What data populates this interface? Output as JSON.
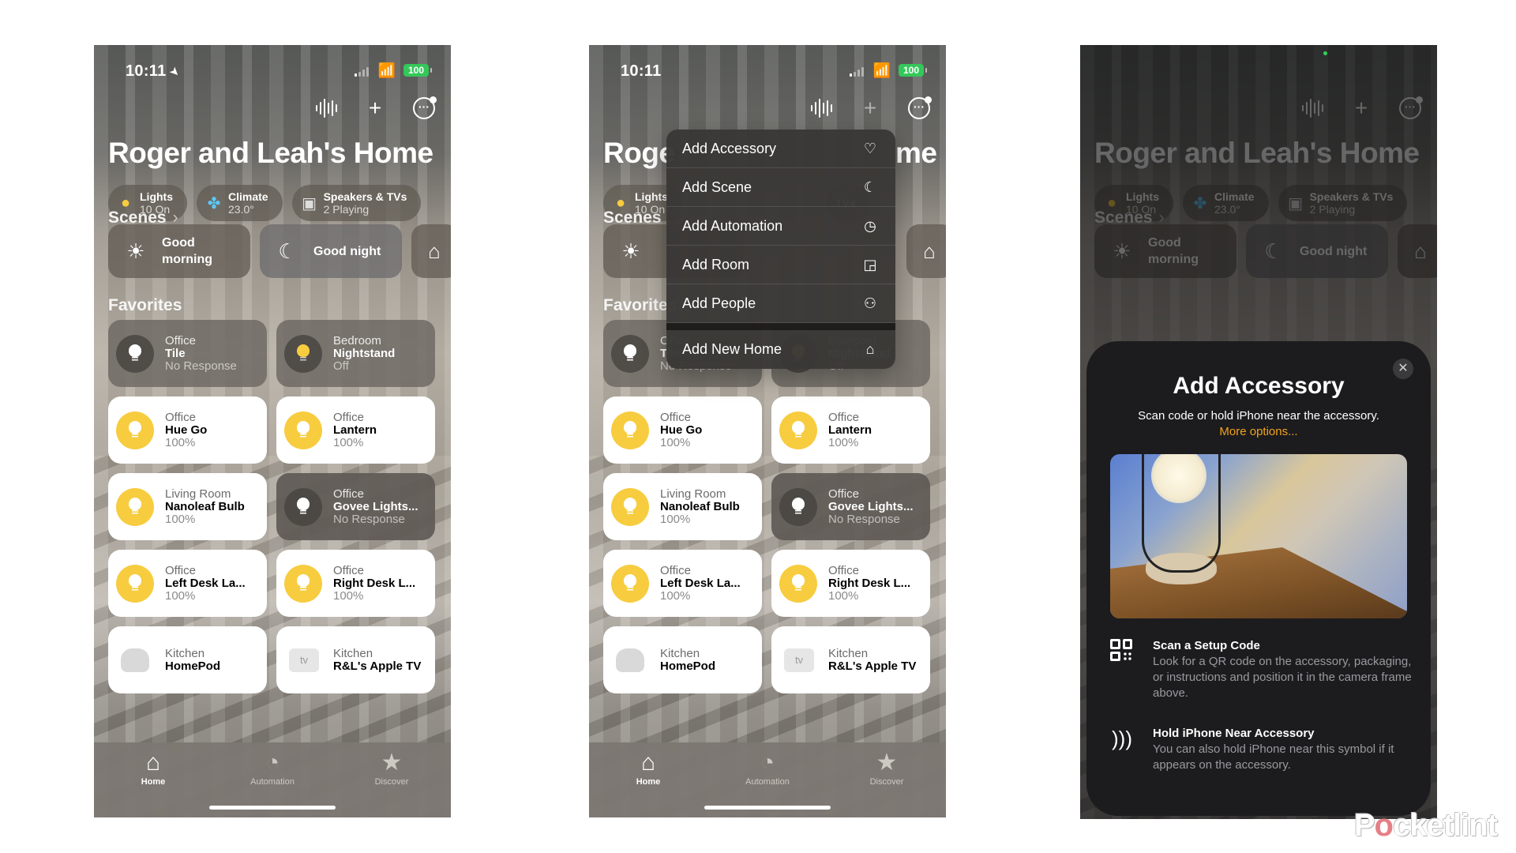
{
  "watermark": {
    "prefix": "P",
    "o": "o",
    "suffix": "cketlint"
  },
  "status": {
    "time": "10:11",
    "battery": "100"
  },
  "home": {
    "title": "Roger and Leah's Home",
    "title_short_left": "Roge",
    "title_short_right": "me",
    "chips": [
      {
        "title": "Lights",
        "subtitle": "10 On",
        "icon": "lightbulb-icon"
      },
      {
        "title": "Climate",
        "subtitle": "23.0°",
        "icon": "fan-icon"
      },
      {
        "title": "Speakers & TVs",
        "subtitle": "2 Playing",
        "icon": "speakers-tv-icon"
      }
    ],
    "scenes_title": "Scenes",
    "scenes": [
      {
        "label": "Good\nmorning",
        "line1": "Good",
        "line2": "morning",
        "icon": "sun-icon"
      },
      {
        "label": "Good night",
        "icon": "moon-icon"
      },
      {
        "label": "",
        "icon": "house-icon"
      }
    ],
    "favorites_title": "Favorites",
    "favorites": [
      {
        "room": "Office",
        "name": "Tile",
        "state": "No Response",
        "style": "off"
      },
      {
        "room": "Bedroom",
        "name": "Nightstand",
        "state": "Off",
        "style": "off"
      },
      {
        "room": "Office",
        "name": "Hue Go",
        "state": "100%",
        "style": "on"
      },
      {
        "room": "Office",
        "name": "Lantern",
        "state": "100%",
        "style": "on"
      },
      {
        "room": "Living Room",
        "name": "Nanoleaf Bulb",
        "state": "100%",
        "style": "on"
      },
      {
        "room": "Office",
        "name": "Govee Lights...",
        "state": "No Response",
        "style": "dark"
      },
      {
        "room": "Office",
        "name": "Left Desk La...",
        "state": "100%",
        "style": "on"
      },
      {
        "room": "Office",
        "name": "Right Desk L...",
        "state": "100%",
        "style": "on"
      },
      {
        "room": "Kitchen",
        "name": "HomePod",
        "state": "",
        "style": "homepod"
      },
      {
        "room": "Kitchen",
        "name": "R&L's Apple TV",
        "state": "",
        "style": "appletv"
      }
    ],
    "tabs": [
      {
        "label": "Home",
        "icon": "house-icon",
        "active": true
      },
      {
        "label": "Automation",
        "icon": "clock-check-icon",
        "active": false
      },
      {
        "label": "Discover",
        "icon": "star-icon",
        "active": false
      }
    ]
  },
  "add_menu": {
    "items": [
      {
        "label": "Add Accessory",
        "icon": "lightbulb-icon",
        "glyph": "💡"
      },
      {
        "label": "Add Scene",
        "icon": "moon-sparkle-icon",
        "glyph": "☾"
      },
      {
        "label": "Add Automation",
        "icon": "alarm-clock-icon",
        "glyph": "⏰"
      },
      {
        "label": "Add Room",
        "icon": "room-icon",
        "glyph": "◲"
      },
      {
        "label": "Add People",
        "icon": "people-icon",
        "glyph": "👥"
      }
    ],
    "footer_item": {
      "label": "Add New Home",
      "icon": "house-icon",
      "glyph": "⌂"
    }
  },
  "add_accessory_sheet": {
    "title": "Add Accessory",
    "subtitle": "Scan code or hold iPhone near the accessory.",
    "more_options": "More options...",
    "more_options_color": "#f0a21c",
    "options": [
      {
        "heading": "Scan a Setup Code",
        "body": "Look for a QR code on the accessory, packaging, or instructions and position it in the camera frame above.",
        "icon": "qr-code-icon"
      },
      {
        "heading": "Hold iPhone Near Accessory",
        "body": "You can also hold iPhone near this symbol if it appears on the accessory.",
        "icon": "nfc-waves-icon"
      }
    ]
  }
}
